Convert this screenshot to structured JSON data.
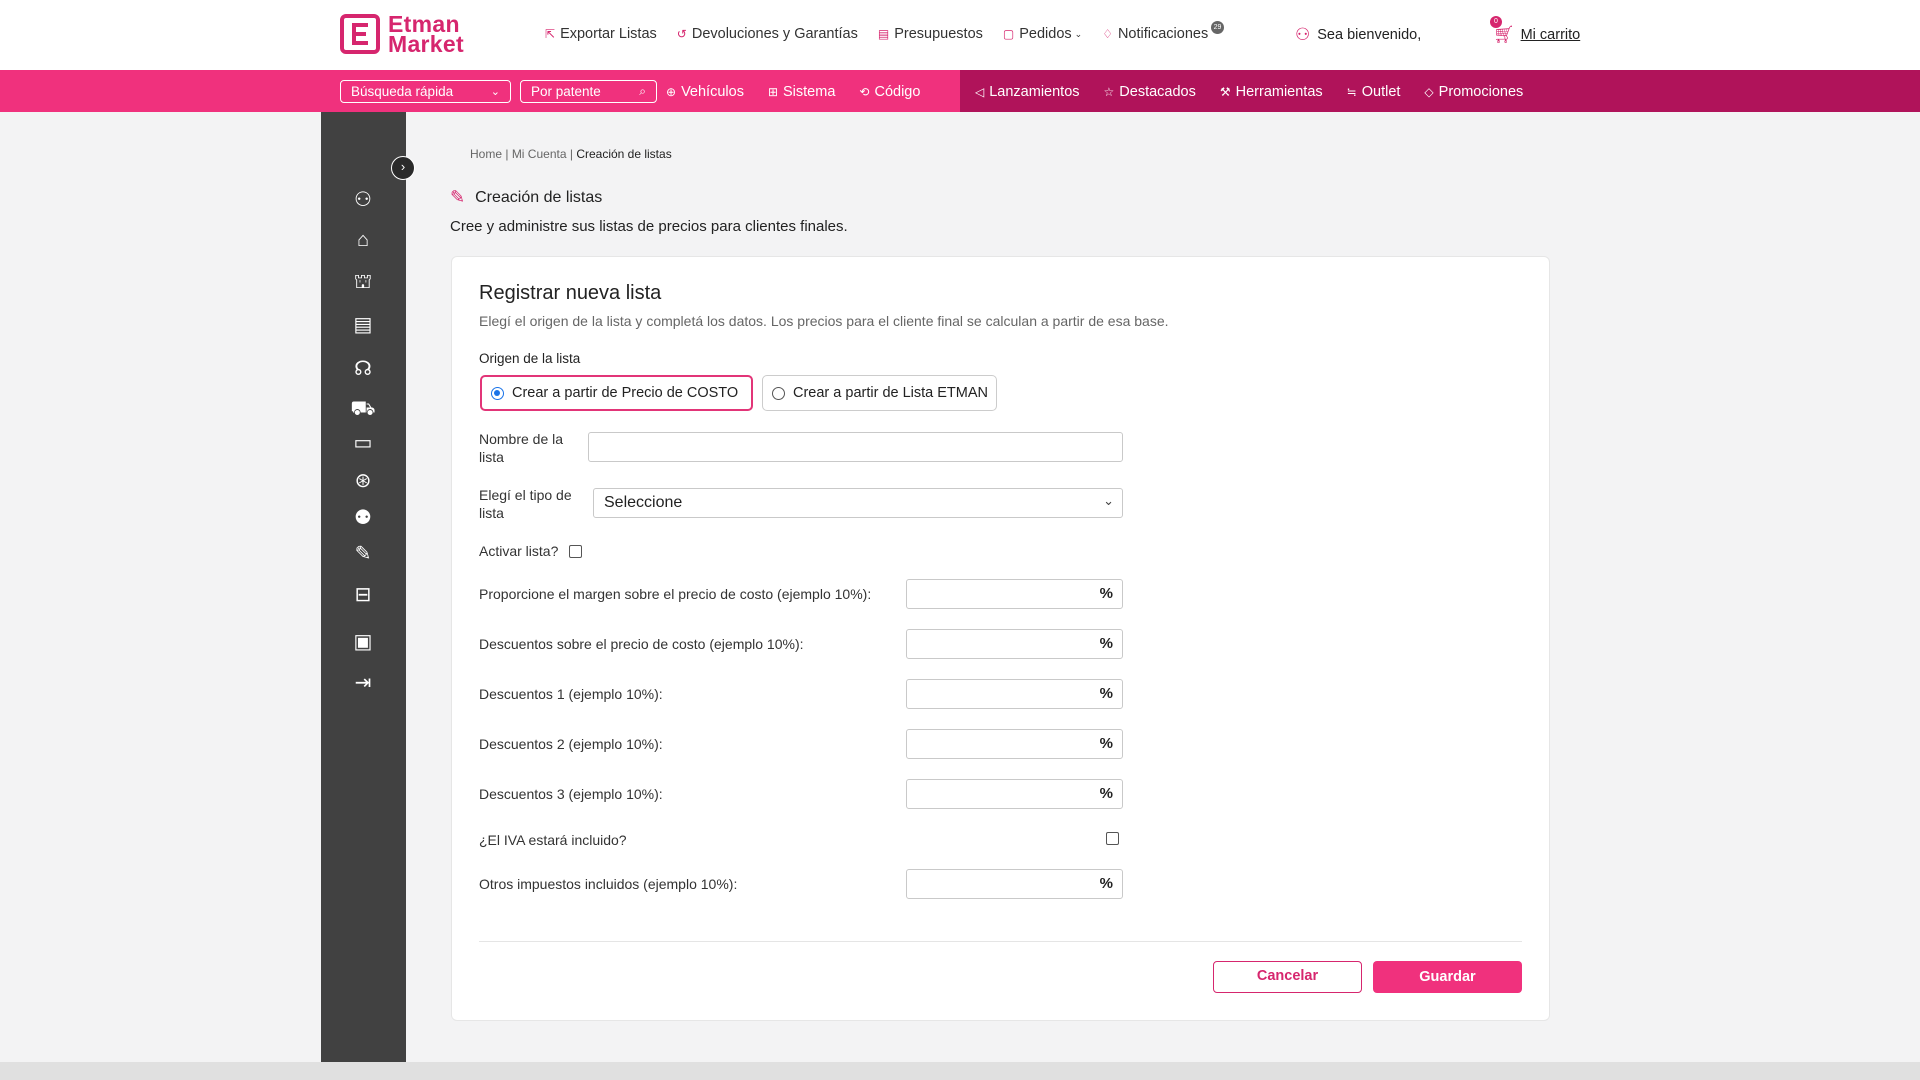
{
  "brand": {
    "name_line1": "Etman",
    "name_line2": "Market",
    "accent": "#d6266e",
    "bar_color": "#f0317d",
    "bar_dark": "#b0135a"
  },
  "topnav": [
    {
      "label": "Exportar Listas",
      "icon": "export-icon"
    },
    {
      "label": "Devoluciones y Garantías",
      "icon": "returns-icon"
    },
    {
      "label": "Presupuestos",
      "icon": "budget-icon"
    },
    {
      "label": "Pedidos",
      "icon": "orders-icon"
    },
    {
      "label": "Notificaciones",
      "icon": "bell-icon"
    }
  ],
  "notif_count": "29",
  "welcome": "Sea bienvenido,",
  "cart": {
    "label": "Mi carrito",
    "count": "0"
  },
  "searchbar": {
    "quick_search": "Búsqueda rápida",
    "by_plate": "Por patente"
  },
  "pinknav_left": [
    {
      "label": "Vehículos",
      "icon": "vehicle-icon"
    },
    {
      "label": "Sistema",
      "icon": "grid-icon"
    },
    {
      "label": "Código",
      "icon": "code-icon"
    }
  ],
  "pinknav_right": [
    {
      "label": "Lanzamientos",
      "icon": "megaphone-icon"
    },
    {
      "label": "Destacados",
      "icon": "star-icon"
    },
    {
      "label": "Herramientas",
      "icon": "tools-icon"
    },
    {
      "label": "Outlet",
      "icon": "outlet-icon"
    },
    {
      "label": "Promociones",
      "icon": "tag-icon"
    }
  ],
  "sidebar_icons": [
    "user-icon",
    "bank-icon",
    "institution-icon",
    "invoice-icon",
    "headset-icon",
    "truck-icon",
    "card-icon",
    "discount-icon",
    "group-icon",
    "edit-list-icon",
    "basket-icon",
    "book-icon",
    "logout-icon"
  ],
  "breadcrumb": {
    "home": "Home",
    "account": "Mi Cuenta",
    "current": "Creación de listas"
  },
  "page": {
    "title": "Creación de listas",
    "subtitle": "Cree y administre sus listas de precios para clientes finales."
  },
  "form": {
    "title": "Registrar nueva lista",
    "subtitle": "Elegí el origen de la lista y completá los datos. Los precios para el cliente final se calculan a partir de esa base.",
    "origin_label": "Origen de la lista",
    "origin_options": [
      "Crear a partir de Precio de COSTO",
      "Crear a partir de Lista ETMAN"
    ],
    "origin_selected": "Crear a partir de Precio de COSTO",
    "name_label": "Nombre de la lista",
    "name_value": "",
    "type_label": "Elegí el tipo de lista",
    "type_value": "Seleccione",
    "active_label": "Activar lista?",
    "margin_label": "Proporcione el margen sobre el precio de costo (ejemplo 10%):",
    "cost_discount_label": "Descuentos sobre el precio de costo (ejemplo 10%):",
    "discount1_label": "Descuentos 1 (ejemplo 10%):",
    "discount2_label": "Descuentos 2 (ejemplo 10%):",
    "discount3_label": "Descuentos 3 (ejemplo 10%):",
    "iva_label": "¿El IVA estará incluido?",
    "other_taxes_label": "Otros impuestos incluidos (ejemplo 10%):",
    "pct_symbol": "%",
    "cancel": "Cancelar",
    "save": "Guardar"
  }
}
